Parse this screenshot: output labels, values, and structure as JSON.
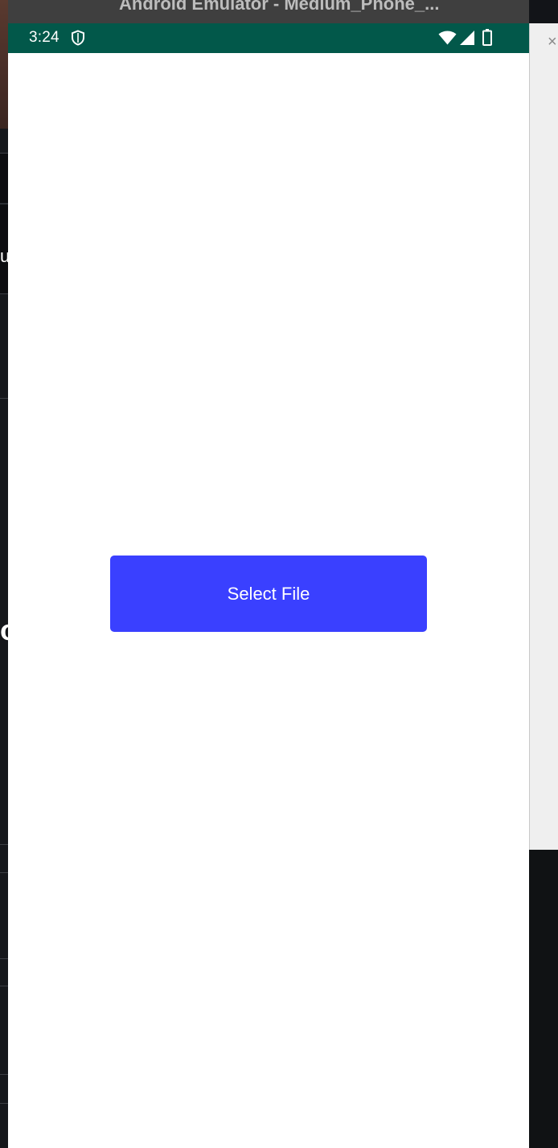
{
  "window": {
    "title": "Android Emulator - Medium_Phone_..."
  },
  "status_bar": {
    "time": "3:24",
    "icons": [
      "shield-icon",
      "wifi-icon",
      "cell-signal-icon",
      "battery-icon"
    ],
    "color": "#02584a"
  },
  "app": {
    "select_file_button_label": "Select File",
    "button_color": "#3a40ff"
  },
  "background_fragments": {
    "upper": "us",
    "lower": "o"
  },
  "side_panel": {
    "close_glyph": "×"
  }
}
